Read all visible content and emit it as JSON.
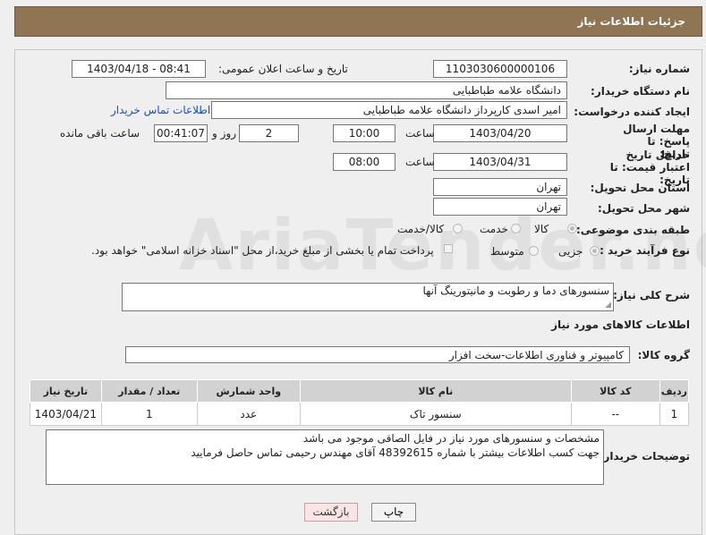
{
  "header": {
    "title": "جزئیات اطلاعات نیاز"
  },
  "labels": {
    "need_number": "شماره نیاز:",
    "announce_datetime": "تاریخ و ساعت اعلان عمومی:",
    "buyer_org": "نام دستگاه خریدار:",
    "requester": "ایجاد کننده درخواست:",
    "reply_deadline": "مهلت ارسال پاسخ: تا تاریخ:",
    "hour": "ساعت",
    "day_and": "روز و",
    "remaining": "ساعت باقی مانده",
    "price_validity": "حداقل تاریخ اعتبار قیمت: تا تاریخ:",
    "delivery_province": "استان محل تحویل:",
    "delivery_city": "شهر محل تحویل:",
    "category": "طبقه بندی موضوعی:",
    "purchase_type": "نوع فرآیند خرید :",
    "description": "شرح کلی نیاز:",
    "goods_info": "اطلاعات کالاهای مورد نیاز",
    "goods_group": "گروه کالا:",
    "buyer_notes": "توضیحات خریدار:"
  },
  "fields": {
    "need_number": "1103030600000106",
    "announce_datetime": "1403/04/18 - 08:41",
    "buyer_org": "دانشگاه علامه طباطبایی",
    "requester": "امیر اسدی کارپرداز دانشگاه علامه طباطبایی",
    "buyer_contact_link": "اطلاعات تماس خریدار",
    "reply_date": "1403/04/20",
    "reply_time": "10:00",
    "days_left": "2",
    "time_left": "00:41:07",
    "validity_date": "1403/04/31",
    "validity_time": "08:00",
    "province": "تهران",
    "city": "تهران"
  },
  "category_options": [
    {
      "label": "کالا",
      "selected": true
    },
    {
      "label": "خدمت",
      "selected": false
    },
    {
      "label": "کالا/خدمت",
      "selected": false
    }
  ],
  "purchase_options": [
    {
      "label": "جزیی",
      "selected": true
    },
    {
      "label": "متوسط",
      "selected": false
    }
  ],
  "payment_note": "پرداخت تمام یا بخشی از مبلغ خرید،از محل \"اسناد خزانه اسلامی\" خواهد بود.",
  "description": "سنسورهای دما و رطوبت و مانیتورینگ آنها",
  "goods_group": "کامپیوتر و فناوری اطلاعات-سخت افزار",
  "table": {
    "headers": [
      "ردیف",
      "کد کالا",
      "نام کالا",
      "واحد شمارش",
      "تعداد / مقدار",
      "تاریخ نیاز"
    ],
    "rows": [
      [
        "1",
        "--",
        "سنسور تاک",
        "عدد",
        "1",
        "1403/04/21"
      ]
    ]
  },
  "buyer_notes": [
    "مشخصات و سنسورهای مورد نیاز در فایل الصاقی موجود می باشد",
    "جهت کسب اطلاعات بیشتر با شماره 48392615 آقای مهندس رحیمی تماس حاصل فرمایید"
  ],
  "buttons": {
    "print": "چاپ",
    "back": "بازگشت"
  }
}
